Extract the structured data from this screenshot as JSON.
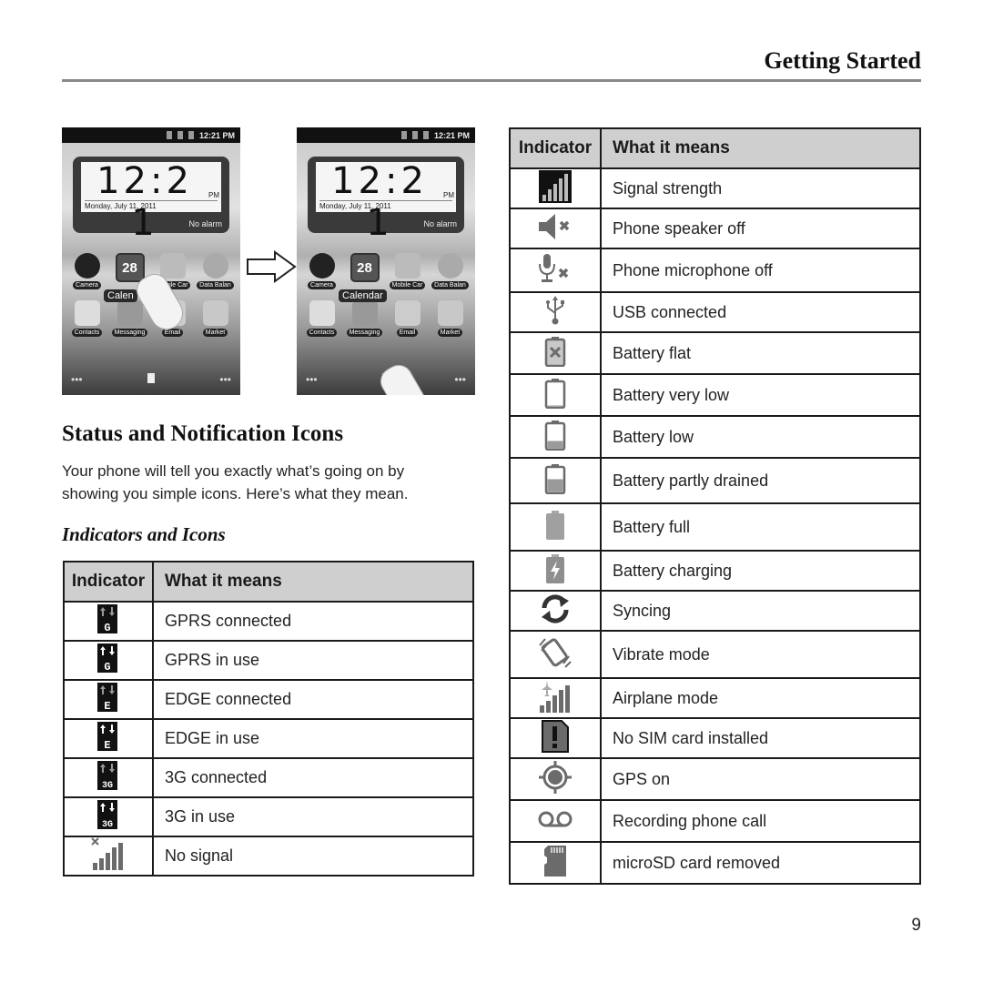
{
  "header": {
    "running_head": "Getting Started"
  },
  "screenshots": {
    "status_time": "12:21 PM",
    "clock_time": "12:2 1",
    "clock_ampm": "PM",
    "clock_date": "Monday, July 11, 2011",
    "clock_alarm": "No alarm",
    "apps_row1": [
      "Camera",
      "Calendar",
      "Mobile Car",
      "Data Balan"
    ],
    "apps_row2": [
      "Contacts",
      "Messaging",
      "Email",
      "Market"
    ],
    "calendar_day": "28",
    "tooltip_before": "Calen",
    "tooltip_after": "Calendar",
    "dock_left": "•••",
    "dock_right": "•••"
  },
  "section": {
    "title": "Status and Notification Icons",
    "intro": "Your phone will tell you exactly what’s going on by showing you simple icons. Here’s what they mean.",
    "subtitle": "Indicators and Icons"
  },
  "table_headers": {
    "indicator": "Indicator",
    "meaning": "What it means"
  },
  "left_table": [
    {
      "icon": "gprs-connected-icon",
      "meaning": "GPRS connected"
    },
    {
      "icon": "gprs-in-use-icon",
      "meaning": "GPRS in use"
    },
    {
      "icon": "edge-connected-icon",
      "meaning": "EDGE connected"
    },
    {
      "icon": "edge-in-use-icon",
      "meaning": "EDGE in use"
    },
    {
      "icon": "3g-connected-icon",
      "meaning": "3G connected"
    },
    {
      "icon": "3g-in-use-icon",
      "meaning": "3G in use"
    },
    {
      "icon": "no-signal-icon",
      "meaning": "No signal"
    }
  ],
  "right_table": [
    {
      "icon": "signal-strength-icon",
      "meaning": "Signal strength"
    },
    {
      "icon": "speaker-off-icon",
      "meaning": "Phone speaker off"
    },
    {
      "icon": "microphone-off-icon",
      "meaning": "Phone microphone off"
    },
    {
      "icon": "usb-icon",
      "meaning": "USB connected"
    },
    {
      "icon": "battery-flat-icon",
      "meaning": "Battery flat"
    },
    {
      "icon": "battery-very-low-icon",
      "meaning": "Battery very low"
    },
    {
      "icon": "battery-low-icon",
      "meaning": "Battery low"
    },
    {
      "icon": "battery-partly-drained-icon",
      "meaning": "Battery partly drained"
    },
    {
      "icon": "battery-full-icon",
      "meaning": "Battery full"
    },
    {
      "icon": "battery-charging-icon",
      "meaning": "Battery charging"
    },
    {
      "icon": "sync-icon",
      "meaning": "Syncing"
    },
    {
      "icon": "vibrate-icon",
      "meaning": "Vibrate mode"
    },
    {
      "icon": "airplane-mode-icon",
      "meaning": "Airplane mode"
    },
    {
      "icon": "no-sim-icon",
      "meaning": "No SIM card installed"
    },
    {
      "icon": "gps-icon",
      "meaning": "GPS on"
    },
    {
      "icon": "voicemail-recording-icon",
      "meaning": "Recording phone call"
    },
    {
      "icon": "microsd-icon",
      "meaning": "microSD card removed"
    }
  ],
  "footer": {
    "page_number": "9"
  }
}
